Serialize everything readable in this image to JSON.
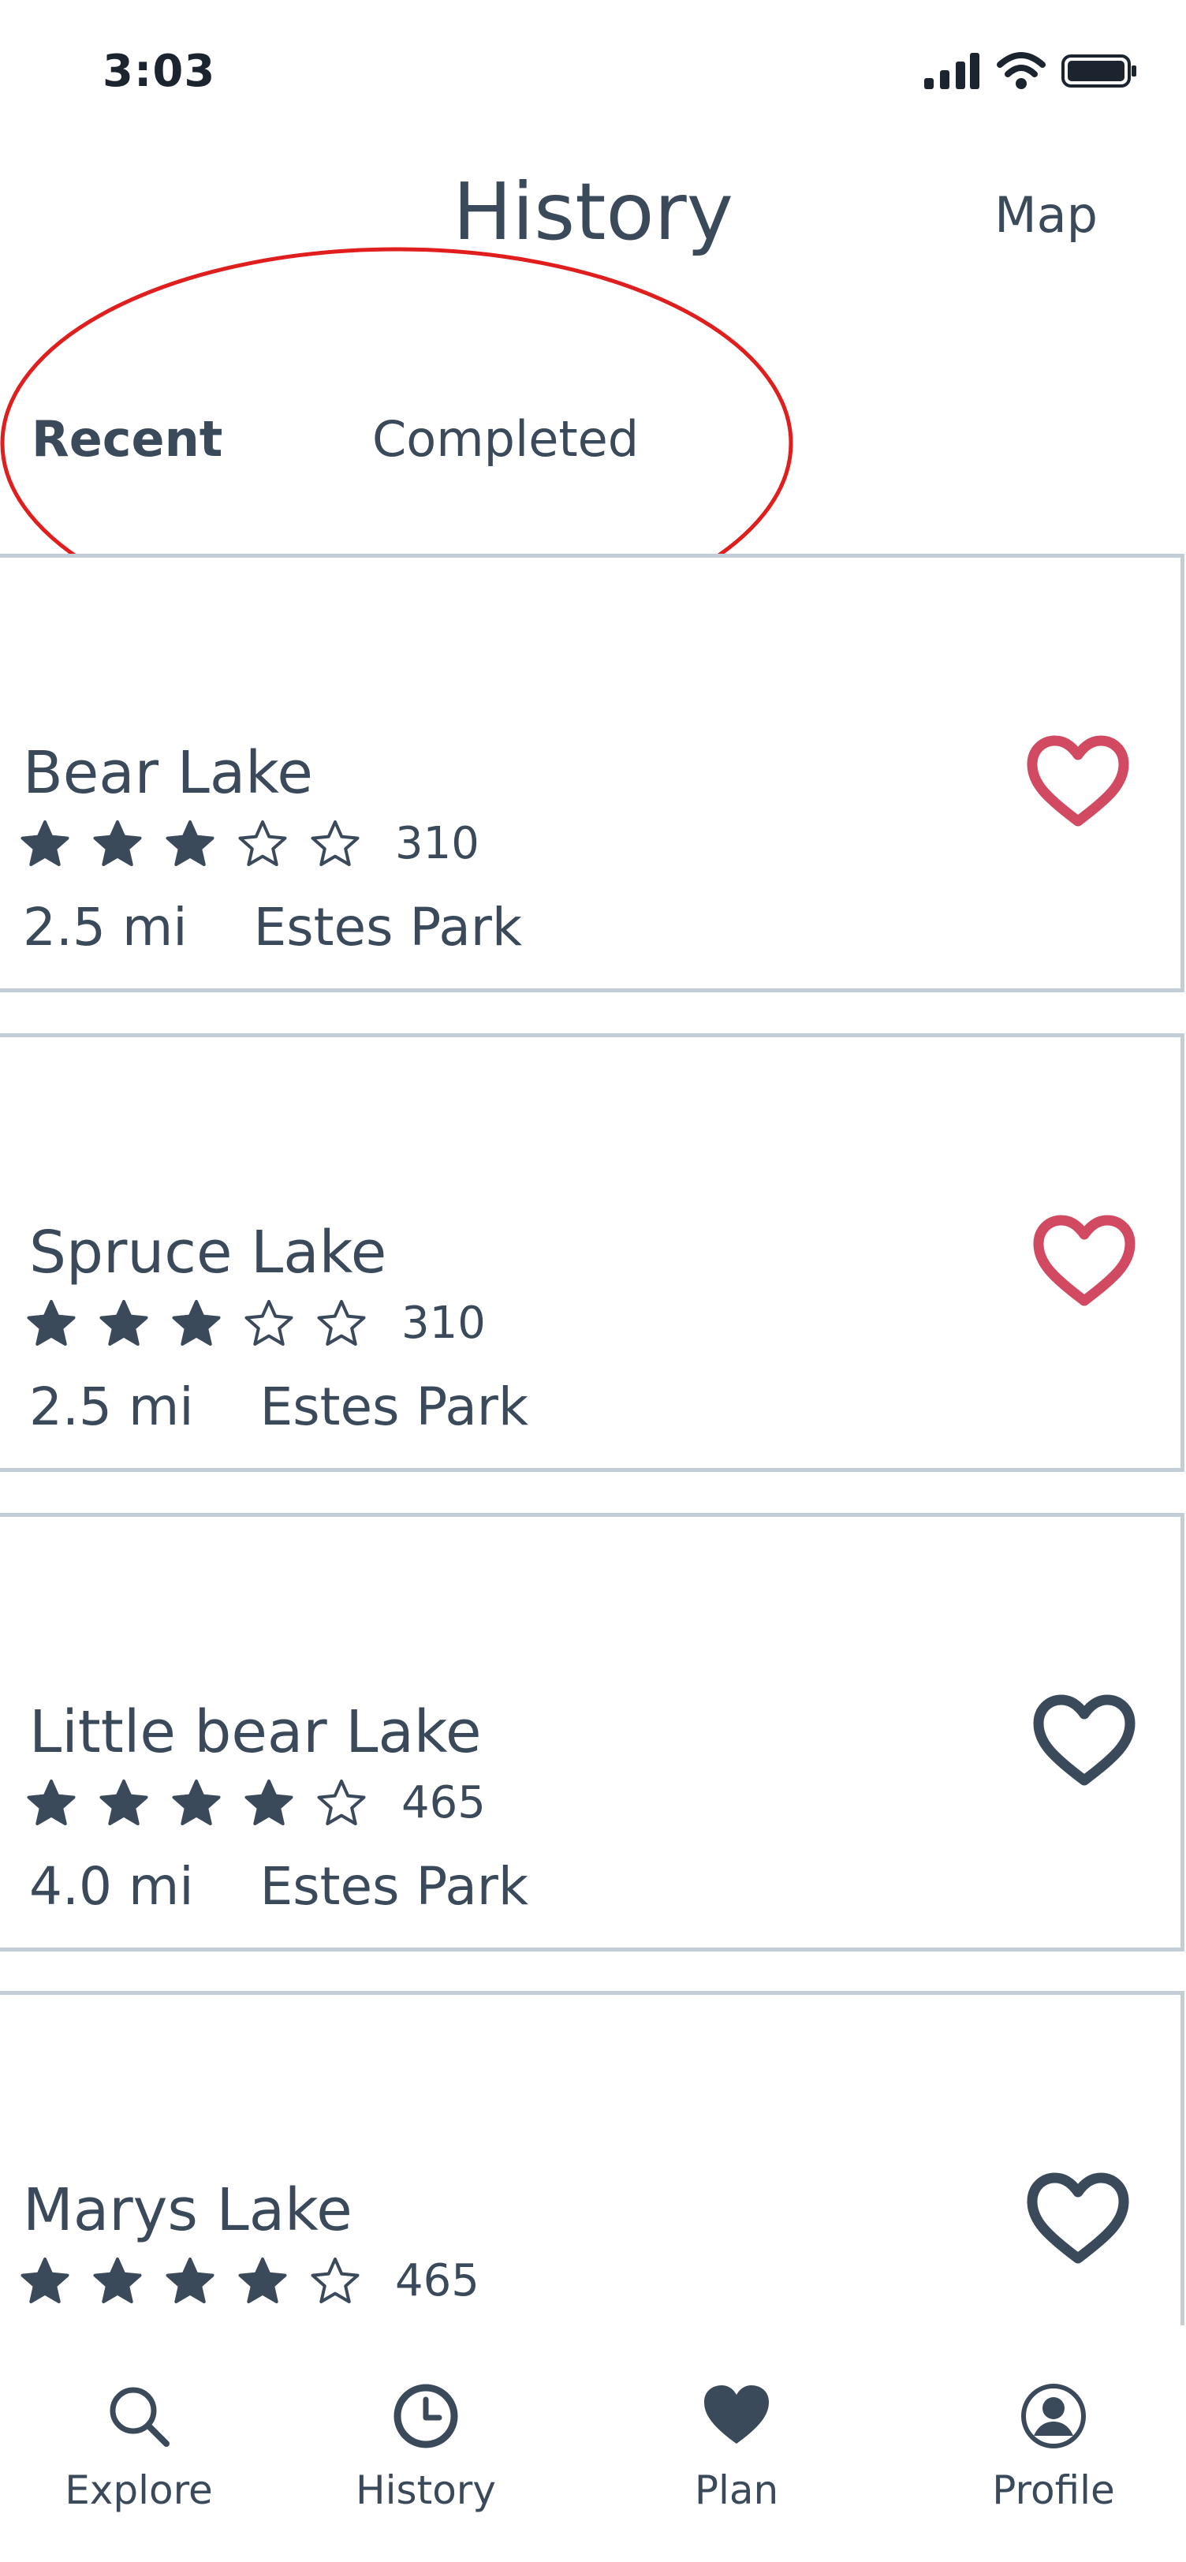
{
  "status_bar": {
    "time": "3:03"
  },
  "header": {
    "title": "History",
    "map_label": "Map"
  },
  "tabs": [
    {
      "label": "Recent",
      "active": true
    },
    {
      "label": "Completed",
      "active": false
    }
  ],
  "hikes": [
    {
      "name": "Bear Lake",
      "rating": 3,
      "reviews": "310",
      "distance": "2.5 mi",
      "location": "Estes Park",
      "favorited": true
    },
    {
      "name": "Spruce Lake",
      "rating": 3,
      "reviews": "310",
      "distance": "2.5 mi",
      "location": "Estes Park",
      "favorited": true
    },
    {
      "name": "Little bear Lake",
      "rating": 4,
      "reviews": "465",
      "distance": "4.0 mi",
      "location": "Estes Park",
      "favorited": false
    },
    {
      "name": "Marys Lake",
      "rating": 4,
      "reviews": "465",
      "distance": "",
      "location": "",
      "favorited": false
    }
  ],
  "bottom_nav": {
    "items": [
      {
        "label": "Explore",
        "icon": "search-icon"
      },
      {
        "label": "History",
        "icon": "clock-icon"
      },
      {
        "label": "Plan",
        "icon": "heart-icon"
      },
      {
        "label": "Profile",
        "icon": "user-circle-icon"
      }
    ]
  },
  "colors": {
    "text": "#3b4a5a",
    "favorite": "#d24a62",
    "border": "#c3cdd7",
    "annotation": "#e01e1e"
  }
}
